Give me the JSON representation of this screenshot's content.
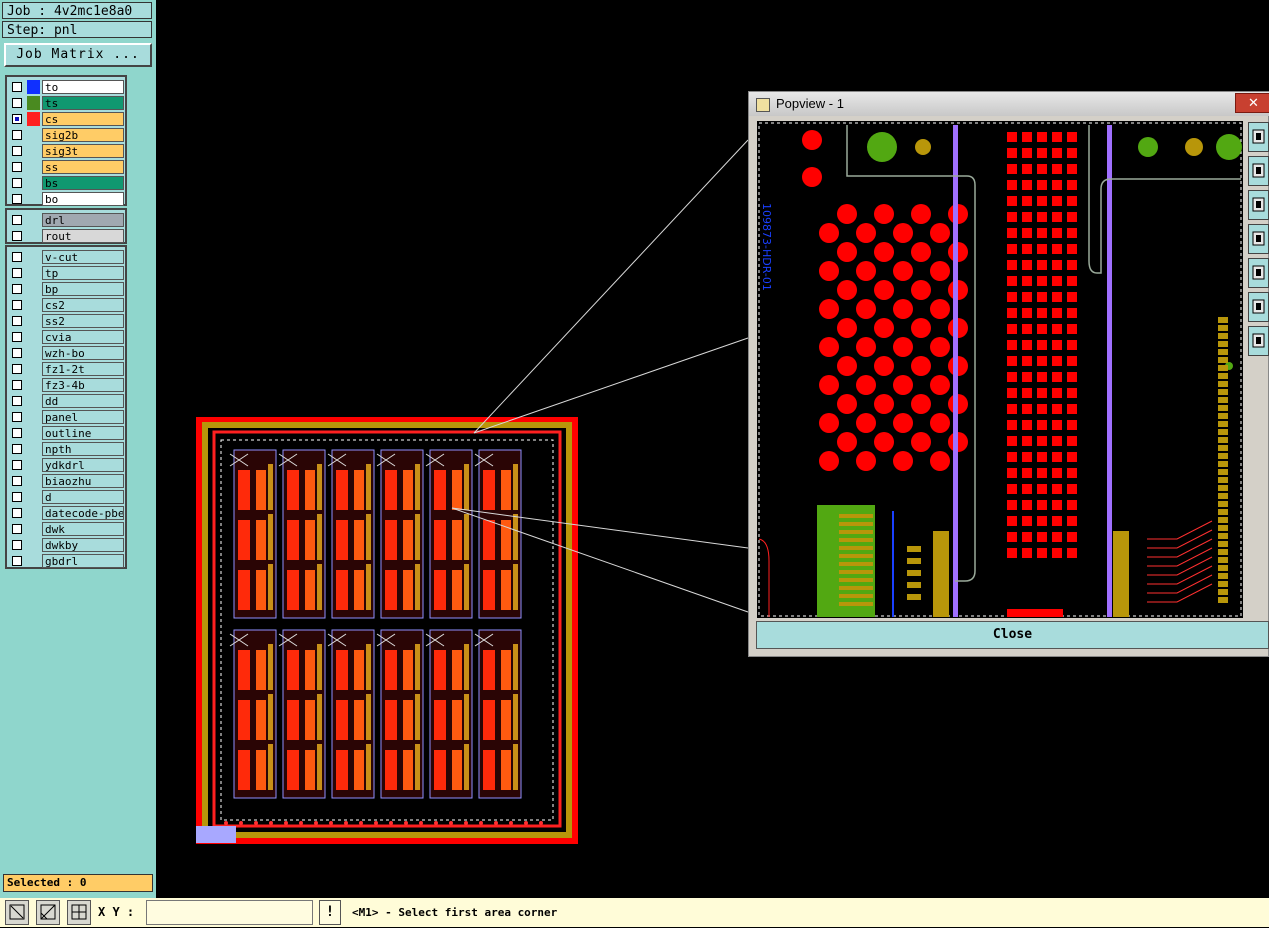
{
  "job_label": "Job : 4v2mc1e8a0",
  "step_label": "Step: pnl",
  "job_matrix_button": "Job Matrix ...",
  "layers_board": [
    {
      "name": "to",
      "swatch": "#1030ff",
      "bg": "#ffffff"
    },
    {
      "name": "ts",
      "swatch": "#4a8a20",
      "bg": "#109870"
    },
    {
      "name": "cs",
      "swatch": "#ff2020",
      "bg": "#ffcc66",
      "active": true
    },
    {
      "name": "sig2b",
      "swatch": "",
      "bg": "#ffcc66"
    },
    {
      "name": "sig3t",
      "swatch": "",
      "bg": "#ffcc66"
    },
    {
      "name": "ss",
      "swatch": "",
      "bg": "#ffcc66"
    },
    {
      "name": "bs",
      "swatch": "",
      "bg": "#109870"
    },
    {
      "name": "bo",
      "swatch": "",
      "bg": "#ffffff"
    }
  ],
  "layers_drill": [
    {
      "name": "drl",
      "bg": "#a0a8b0"
    },
    {
      "name": "rout",
      "bg": "#d8d8d8"
    }
  ],
  "layers_misc": [
    {
      "name": "v-cut"
    },
    {
      "name": "tp"
    },
    {
      "name": "bp"
    },
    {
      "name": "cs2"
    },
    {
      "name": "ss2"
    },
    {
      "name": "cvia"
    },
    {
      "name": "wzh-bo"
    },
    {
      "name": "fz1-2t"
    },
    {
      "name": "fz3-4b"
    },
    {
      "name": "dd"
    },
    {
      "name": "panel"
    },
    {
      "name": "outline"
    },
    {
      "name": "npth"
    },
    {
      "name": "ydkdrl"
    },
    {
      "name": "biaozhu"
    },
    {
      "name": "d"
    },
    {
      "name": "datecode-pbe"
    },
    {
      "name": "dwk"
    },
    {
      "name": "dwkby"
    },
    {
      "name": "gbdrl"
    }
  ],
  "selected_label": "Selected : 0",
  "xy_label": "X Y :",
  "xy_value": "",
  "status_message": "<M1> - Select first area corner",
  "popview_title": "Popview - 1",
  "popview_close": "Close",
  "popview_part_label": "109873-HDR-01",
  "colors": {
    "panel_bg": "#8fd6cc",
    "layer_active": "#ffcc66",
    "board_layer_ts": "#109870",
    "copper_red": "#ff0000",
    "pad_green": "#52a812",
    "gold": "#b8960a"
  }
}
